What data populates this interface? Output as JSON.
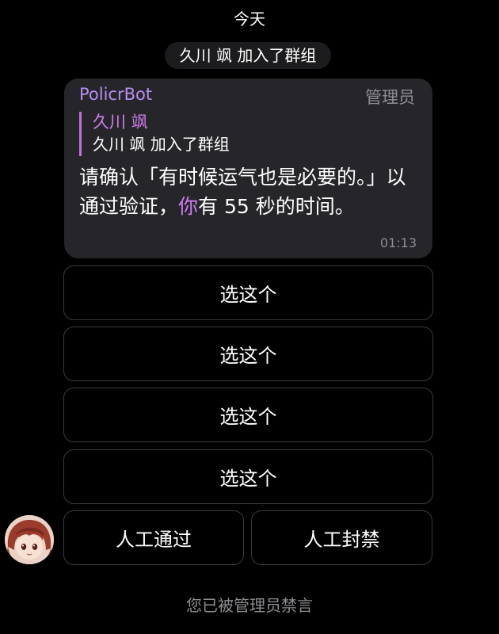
{
  "chat": {
    "date_label": "今天",
    "service_message": "久川 飒 加入了群组"
  },
  "message": {
    "sender": "PolicrBot",
    "role_badge": "管理员",
    "reply": {
      "name": "久川 飒",
      "text": "久川 飒 加入了群组"
    },
    "text_before": "请确认「有时候运气也是必要的。」以通过验证，",
    "mention": "你",
    "text_after": "有 55 秒的时间。",
    "time": "01:13"
  },
  "keyboard": {
    "options": [
      "选这个",
      "选这个",
      "选这个",
      "选这个"
    ],
    "manual_approve": "人工通过",
    "manual_ban": "人工封禁"
  },
  "footer": {
    "muted_text": "您已被管理员禁言"
  },
  "colors": {
    "background": "#000000",
    "bubble": "#26262a",
    "accent_sender": "#b98df0",
    "accent_mention": "#cf7df0",
    "muted_text": "#8e8e93"
  }
}
